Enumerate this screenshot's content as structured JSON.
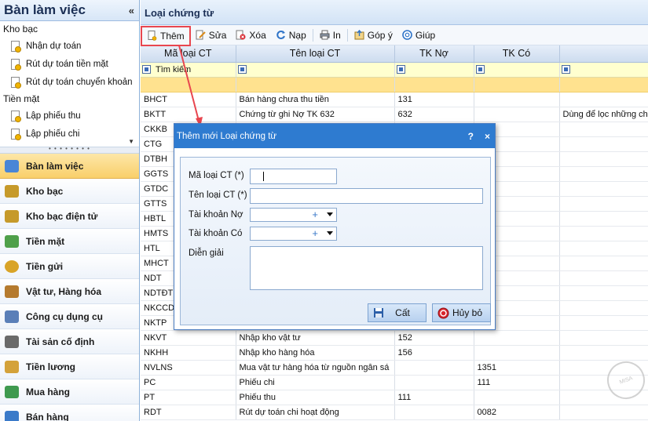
{
  "left_panel": {
    "title": "Bàn làm việc",
    "collapse_label": "«",
    "tree": [
      {
        "group": "Kho bạc",
        "items": [
          "Nhận dự toán",
          "Rút dự toán tiền mặt",
          "Rút dự toán chuyển khoản"
        ]
      },
      {
        "group": "Tiền mặt",
        "items": [
          "Lập phiếu thu",
          "Lập phiếu chi"
        ]
      }
    ],
    "nav": [
      {
        "label": "Bàn làm việc",
        "active": true,
        "color": "#4a86d6"
      },
      {
        "label": "Kho bạc",
        "active": false,
        "color": "#c69a2a"
      },
      {
        "label": "Kho bạc điện tử",
        "active": false,
        "color": "#c69a2a"
      },
      {
        "label": "Tiền mặt",
        "active": false,
        "color": "#4fa04a"
      },
      {
        "label": "Tiền gửi",
        "active": false,
        "color": "#d9a428"
      },
      {
        "label": "Vật tư, Hàng hóa",
        "active": false,
        "color": "#b57a2e"
      },
      {
        "label": "Công cụ dụng cụ",
        "active": false,
        "color": "#5a7fb8"
      },
      {
        "label": "Tài sản cố định",
        "active": false,
        "color": "#6a6a6a"
      },
      {
        "label": "Tiền lương",
        "active": false,
        "color": "#d4a23a"
      },
      {
        "label": "Mua hàng",
        "active": false,
        "color": "#3f9a4f"
      },
      {
        "label": "Bán hàng",
        "active": false,
        "color": "#3a7ac9"
      }
    ]
  },
  "main": {
    "title": "Loại chứng từ",
    "toolbar": [
      {
        "label": "Thêm",
        "icon": "add-doc-icon",
        "highlight": true
      },
      {
        "label": "Sửa",
        "icon": "edit-icon"
      },
      {
        "label": "Xóa",
        "icon": "delete-icon"
      },
      {
        "label": "Nạp",
        "icon": "refresh-icon"
      },
      {
        "label": "In",
        "icon": "print-icon"
      },
      {
        "label": "Góp ý",
        "icon": "feedback-icon"
      },
      {
        "label": "Giúp",
        "icon": "help-icon"
      }
    ],
    "columns": [
      "Mã loại CT",
      "Tên loại CT",
      "TK Nợ",
      "TK Có",
      ""
    ],
    "filter_placeholder": "Tìm kiếm",
    "rows": [
      [
        "BHCT",
        "Bán hàng chưa thu tiền",
        "131",
        "",
        ""
      ],
      [
        "BKTT",
        "Chứng từ ghi Nợ TK 632",
        "632",
        "",
        "Dùng để lọc những ch"
      ],
      [
        "CKKB",
        "",
        "",
        "",
        ""
      ],
      [
        "CTG",
        "",
        "",
        "",
        ""
      ],
      [
        "DTBH",
        "",
        "",
        "",
        ""
      ],
      [
        "GGTS",
        "",
        "",
        "",
        ""
      ],
      [
        "GTDC",
        "",
        "",
        "",
        ""
      ],
      [
        "GTTS",
        "",
        "",
        "",
        ""
      ],
      [
        "HBTL",
        "",
        "",
        "",
        ""
      ],
      [
        "HMTS",
        "",
        "",
        "",
        ""
      ],
      [
        "HTL",
        "",
        "",
        "",
        ""
      ],
      [
        "MHCT",
        "",
        "",
        "",
        ""
      ],
      [
        "NDT",
        "",
        "",
        "",
        ""
      ],
      [
        "NDTĐT",
        "",
        "",
        "",
        ""
      ],
      [
        "NKCCD",
        "",
        "",
        "",
        ""
      ],
      [
        "NKTP",
        "",
        "",
        "",
        ""
      ],
      [
        "NKVT",
        "Nhập kho vật tư",
        "152",
        "",
        ""
      ],
      [
        "NKHH",
        "Nhập kho hàng hóa",
        "156",
        "",
        ""
      ],
      [
        "NVLNS",
        "Mua vật tư hàng hóa từ nguồn ngân sá",
        "",
        "1351",
        ""
      ],
      [
        "PC",
        "Phiếu chi",
        "",
        "111",
        ""
      ],
      [
        "PT",
        "Phiếu thu",
        "111",
        "",
        ""
      ],
      [
        "RDT",
        "Rút dự toán chi hoạt động",
        "",
        "0082",
        ""
      ]
    ]
  },
  "dialog": {
    "title": "Thêm mới Loại chứng từ",
    "help_label": "?",
    "close_label": "×",
    "fields": {
      "ma_loai_ct": {
        "label": "Mã loại CT (*)",
        "value": ""
      },
      "ten_loai_ct": {
        "label": "Tên loại CT (*)",
        "value": ""
      },
      "tai_khoan_no": {
        "label": "Tài khoản Nợ",
        "value": ""
      },
      "tai_khoan_co": {
        "label": "Tài khoản Có",
        "value": ""
      },
      "dien_giai": {
        "label": "Diễn giải",
        "value": ""
      }
    },
    "save_label": "Cất",
    "cancel_label": "Hủy bỏ",
    "plus_label": "+"
  },
  "colors": {
    "highlight_border": "#e8464f",
    "dialog_header": "#2e7bd0",
    "selected_row": "#ffe28f",
    "filter_row": "#ffffcf"
  }
}
